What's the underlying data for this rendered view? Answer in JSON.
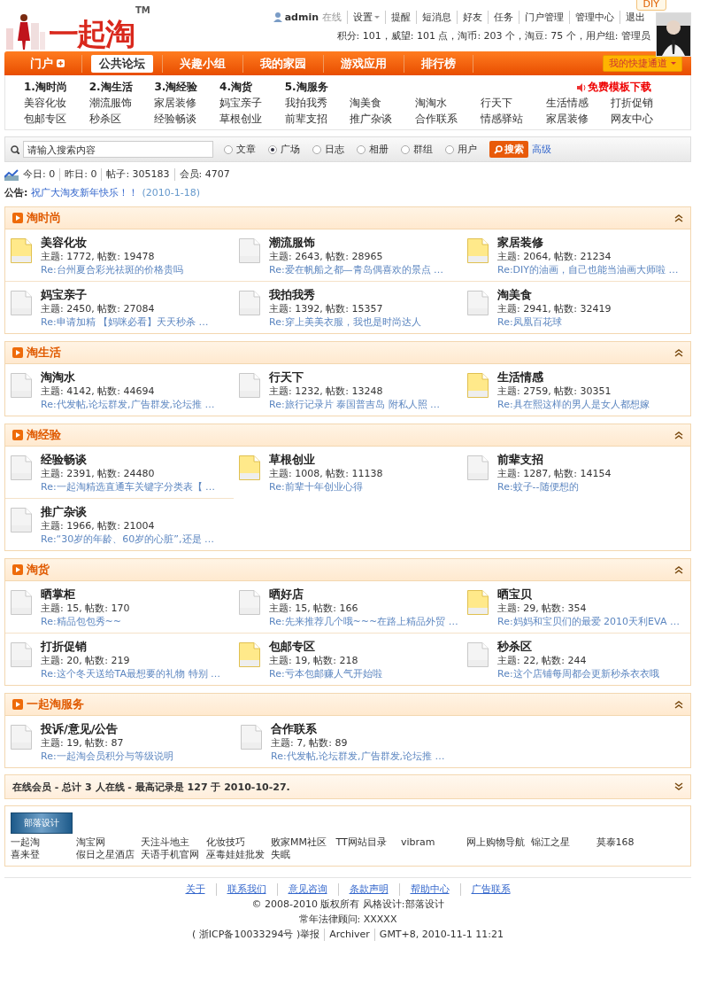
{
  "header": {
    "logo": "一起淘",
    "tm": "TM",
    "user": "admin",
    "online": "在线",
    "links": [
      {
        "label": "设置",
        "dropdown": true
      },
      {
        "label": "提醒",
        "dropdown": false
      },
      {
        "label": "短消息",
        "dropdown": false
      },
      {
        "label": "好友",
        "dropdown": false
      },
      {
        "label": "任务",
        "dropdown": false
      },
      {
        "label": "门户管理",
        "dropdown": false
      },
      {
        "label": "管理中心",
        "dropdown": false
      },
      {
        "label": "退出",
        "dropdown": false
      }
    ],
    "stats": "积分: 101，威望: 101 点，淘币: 203 个，淘豆: 75 个，用户组: 管理员",
    "diy": "DIY"
  },
  "nav": {
    "items": [
      {
        "label": "门户",
        "selected": false,
        "plus": true
      },
      {
        "label": "公共论坛",
        "selected": true,
        "plus": false
      },
      {
        "label": "兴趣小组",
        "selected": false,
        "plus": false
      },
      {
        "label": "我的家园",
        "selected": false,
        "plus": false
      },
      {
        "label": "游戏应用",
        "selected": false,
        "plus": false
      },
      {
        "label": "排行榜",
        "selected": false,
        "plus": false
      }
    ],
    "quick": "我的快捷通道"
  },
  "subnav": {
    "headings": [
      "1.淘时尚",
      "2.淘生活",
      "3.淘经验",
      "4.淘货",
      "5.淘服务"
    ],
    "promo": "免费模板下载",
    "rows": [
      [
        "美容化妆",
        "潮流服饰",
        "家居装修",
        "妈宝亲子",
        "我拍我秀",
        "淘美食",
        "淘淘水",
        "行天下",
        "生活情感",
        "打折促销"
      ],
      [
        "包邮专区",
        "秒杀区",
        "经验畅谈",
        "草根创业",
        "前辈支招",
        "推广杂谈",
        "合作联系",
        "情感驿站",
        "家居装修",
        "网友中心"
      ]
    ]
  },
  "search": {
    "placeholder": "请输入搜索内容",
    "options": [
      {
        "label": "文章",
        "selected": false
      },
      {
        "label": "广场",
        "selected": true
      },
      {
        "label": "日志",
        "selected": false
      },
      {
        "label": "相册",
        "selected": false
      },
      {
        "label": "群组",
        "selected": false
      },
      {
        "label": "用户",
        "selected": false
      }
    ],
    "button": "搜索",
    "advanced": "高级"
  },
  "stats": [
    "今日: 0",
    "昨日: 0",
    "帖子: 305183",
    "会员: 4707"
  ],
  "notice": {
    "label": "公告:",
    "text": "祝广大淘友新年快乐！！",
    "date": "(2010-1-18)"
  },
  "categories": [
    {
      "title": "淘时尚",
      "expanded": true,
      "forums": [
        {
          "name": "美容化妆",
          "counts": "主题: 1772, 帖数: 19478",
          "last": "Re:台州夏合彩光祛斑的价格贵吗",
          "new": true
        },
        {
          "name": "潮流服饰",
          "counts": "主题: 2643, 帖数: 28965",
          "last": "Re:爱在帆船之都—青岛偶喜欢的景点 …",
          "new": false
        },
        {
          "name": "家居装修",
          "counts": "主题: 2064, 帖数: 21234",
          "last": "Re:DIY的油画，自己也能当油画大师啦 …",
          "new": true
        },
        {
          "name": "妈宝亲子",
          "counts": "主题: 2450, 帖数: 27084",
          "last": "Re:申请加精 【妈咪必看】天天秒杀 …",
          "new": false
        },
        {
          "name": "我拍我秀",
          "counts": "主题: 1392, 帖数: 15357",
          "last": "Re:穿上美美衣服，我也是时尚达人",
          "new": false
        },
        {
          "name": "淘美食",
          "counts": "主题: 2941, 帖数: 32419",
          "last": "Re:凤凰百花球",
          "new": false
        }
      ]
    },
    {
      "title": "淘生活",
      "expanded": true,
      "forums": [
        {
          "name": "淘淘水",
          "counts": "主题: 4142, 帖数: 44694",
          "last": "Re:代发帖,论坛群发,广告群发,论坛推 …",
          "new": false
        },
        {
          "name": "行天下",
          "counts": "主题: 1232, 帖数: 13248",
          "last": "Re:旅行记录片 泰国普吉岛 附私人照 …",
          "new": false
        },
        {
          "name": "生活情感",
          "counts": "主题: 2759, 帖数: 30351",
          "last": "Re:具在熙这样的男人是女人都想嫁",
          "new": true
        }
      ]
    },
    {
      "title": "淘经验",
      "expanded": true,
      "forums": [
        {
          "name": "经验畅谈",
          "counts": "主题: 2391, 帖数: 24480",
          "last": "Re:一起淘精选直通车关键字分类表【 …",
          "new": false
        },
        {
          "name": "草根创业",
          "counts": "主题: 1008, 帖数: 11138",
          "last": "Re:前辈十年创业心得",
          "new": true
        },
        {
          "name": "前辈支招",
          "counts": "主题: 1287, 帖数: 14154",
          "last": "Re:蚊子--随便想的",
          "new": false
        },
        {
          "name": "推广杂谈",
          "counts": "主题: 1966, 帖数: 21004",
          "last": "Re:“30岁的年龄、60岁的心脏”,还是 …",
          "new": false
        }
      ]
    },
    {
      "title": "淘货",
      "expanded": true,
      "forums": [
        {
          "name": "晒掌柜",
          "counts": "主题: 15, 帖数: 170",
          "last": "Re:精品包包秀~~",
          "new": false
        },
        {
          "name": "晒好店",
          "counts": "主题: 15, 帖数: 166",
          "last": "Re:先来推荐几个哦~~~在路上精品外贸 …",
          "new": false
        },
        {
          "name": "晒宝贝",
          "counts": "主题: 29, 帖数: 354",
          "last": "Re:妈妈和宝贝们的最爱 2010天利EVA …",
          "new": true
        },
        {
          "name": "打折促销",
          "counts": "主题: 20, 帖数: 219",
          "last": "Re:这个冬天送给TA最想要的礼物 特别 …",
          "new": false
        },
        {
          "name": "包邮专区",
          "counts": "主题: 19, 帖数: 218",
          "last": "Re:亏本包邮赚人气开始啦",
          "new": true
        },
        {
          "name": "秒杀区",
          "counts": "主题: 22, 帖数: 244",
          "last": "Re:这个店铺每周都会更新秒杀衣衣哦",
          "new": false
        }
      ]
    },
    {
      "title": "一起淘服务",
      "expanded": true,
      "forums": [
        {
          "name": "投诉/意见/公告",
          "counts": "主题: 19, 帖数: 87",
          "last": "Re:一起淘会员积分与等级说明",
          "new": false
        },
        {
          "name": "合作联系",
          "counts": "主题: 7, 帖数: 89",
          "last": "Re:代发帖,论坛群发,广告群发,论坛推 …",
          "new": false
        }
      ]
    }
  ],
  "online": {
    "text": "在线会员 - 总计 3 人在线 - 最高记录是 127 于 2010-10-27.",
    "expanded": false
  },
  "friend_links": {
    "banner": "部落设计",
    "items": [
      "一起淘",
      "淘宝网",
      "天注斗地主",
      "化妆技巧",
      "败家MM社区",
      "TT网站目录",
      "vibram",
      "网上购物导航",
      "锦江之星",
      "莫泰168",
      "喜来登",
      "假日之星酒店",
      "天语手机官网",
      "巫毒娃娃批发",
      "失眠"
    ]
  },
  "footer": {
    "links": [
      "关于",
      "联系我们",
      "意见咨询",
      "条款声明",
      "帮助中心",
      "广告联系"
    ],
    "copyright": "© 2008-2010 版权所有 风格设计:部落设计",
    "lawyer": "常年法律顾问: XXXXX",
    "meta": [
      "( 浙ICP备10033294号 )举报",
      "Archiver",
      "GMT+8, 2010-11-1 11:21"
    ]
  }
}
